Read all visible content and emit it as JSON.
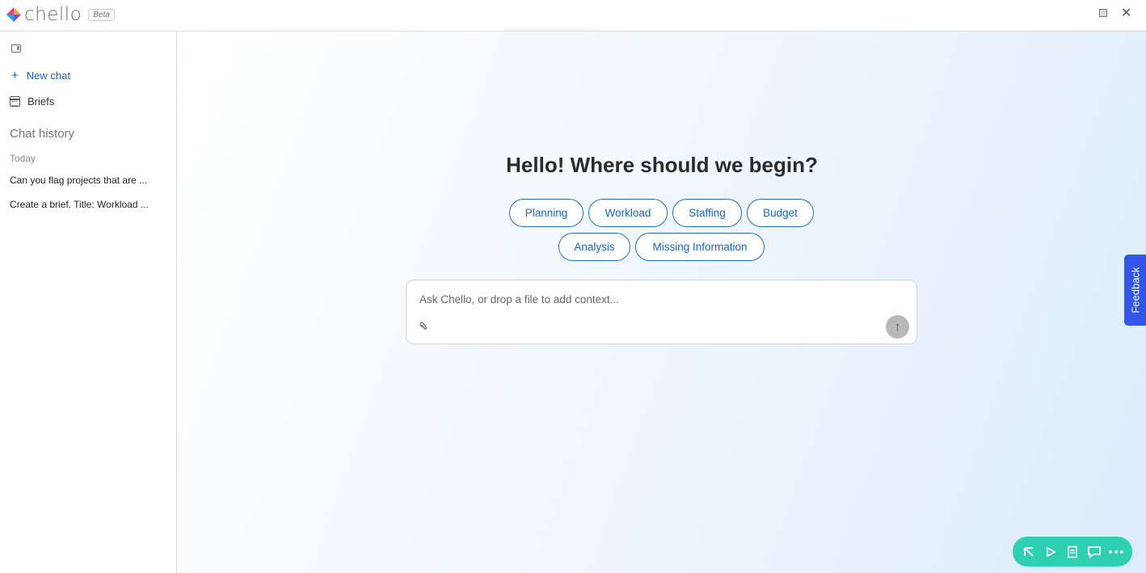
{
  "header": {
    "logo_text": "chello",
    "beta_label": "Beta",
    "restore_glyph": "",
    "close_glyph": "✕",
    "logo_colors": [
      "#f4a72b",
      "#e0457b",
      "#7b4fd6",
      "#2f9fe0"
    ]
  },
  "sidebar": {
    "toggle_icon": "sidebar-toggle-icon",
    "new_chat_label": "New chat",
    "briefs_label": "Briefs",
    "history_title": "Chat history",
    "today_label": "Today",
    "history_items": [
      "Can you flag projects that are ...",
      "Create a brief. Title: Workload ..."
    ]
  },
  "main": {
    "greeting": "Hello! Where should we begin?",
    "chips": [
      "Planning",
      "Workload",
      "Staffing",
      "Budget",
      "Analysis",
      "Missing Information"
    ],
    "composer": {
      "placeholder": "Ask Chello, or drop a file to add context...",
      "value": "",
      "send_glyph": "↑",
      "attach_glyph": "📎"
    },
    "feedback_label": "Feedback"
  },
  "toolbar": {
    "icons": [
      "cursor-arrow-icon",
      "play-icon",
      "document-icon",
      "chat-icon",
      "more-icon"
    ],
    "glyphs": [
      "⇱",
      "▷",
      "▤",
      "▭",
      "•••"
    ]
  },
  "colors": {
    "accent": "#1566b8",
    "feedback": "#3355e8",
    "toolbar": "#2fcfb2"
  }
}
